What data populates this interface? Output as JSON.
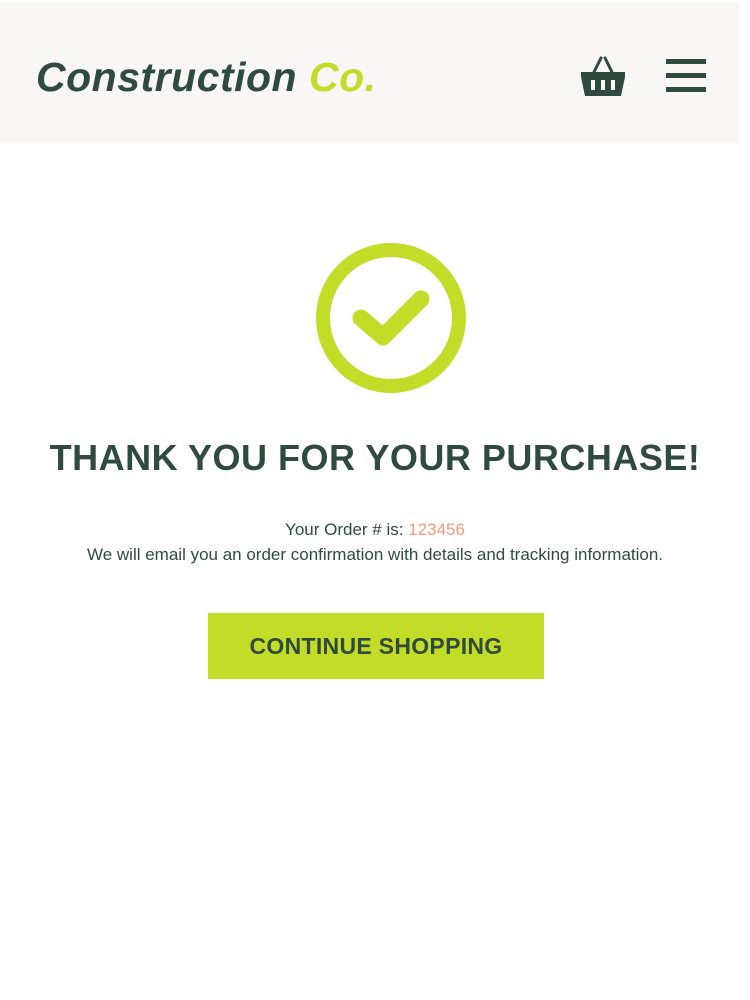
{
  "header": {
    "logo_part1": "Construction",
    "logo_part2": "Co.",
    "cart_icon": "basket-icon",
    "menu_icon": "hamburger-menu-icon"
  },
  "confirmation": {
    "icon": "checkmark-circle-icon",
    "title": "THANK YOU FOR YOUR PURCHASE!",
    "order_label": "Your Order # is:",
    "order_number": "123456",
    "email_message": "We will email you an order confirmation with details and tracking information.",
    "continue_label": "CONTINUE SHOPPING"
  },
  "colors": {
    "brand_dark": "#2f4a3e",
    "brand_accent": "#c3dc28",
    "order_number": "#f39a7b",
    "header_bg": "#f8f7f5"
  }
}
